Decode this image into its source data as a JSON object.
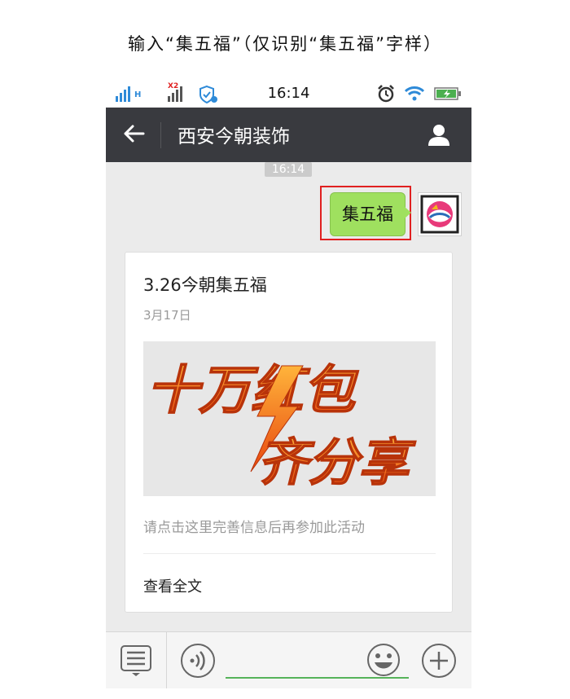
{
  "caption": "输入“集五福”（仅识别“集五福”字样）",
  "status_bar": {
    "time": "16:14",
    "net_label_1": "H",
    "net_label_2": "X2",
    "icons": [
      "signal-icon",
      "shield-icon",
      "alarm-icon",
      "wifi-icon",
      "battery-icon"
    ]
  },
  "header": {
    "title": "西安今朝装饰",
    "back_icon": "back-arrow-icon",
    "user_icon": "user-icon"
  },
  "chat": {
    "timestamp": "16:14",
    "outgoing_message": "集五福",
    "card": {
      "title": "3.26今朝集五福",
      "date": "3月17日",
      "image_line_1": "十万红包",
      "image_line_2": "齐分享",
      "description": "请点击这里完善信息后再参加此活动",
      "link": "查看全文"
    }
  },
  "input_bar": {
    "menu_icon": "menu-icon",
    "voice_icon": "voice-icon",
    "emoji_icon": "emoji-icon",
    "plus_icon": "plus-icon"
  },
  "colors": {
    "bubble": "#9fe05f",
    "header": "#393a3f",
    "chat_bg": "#ebebeb",
    "highlight": "#e02020",
    "accent": "#2e8ad8",
    "image_text": "#f26b1d"
  }
}
